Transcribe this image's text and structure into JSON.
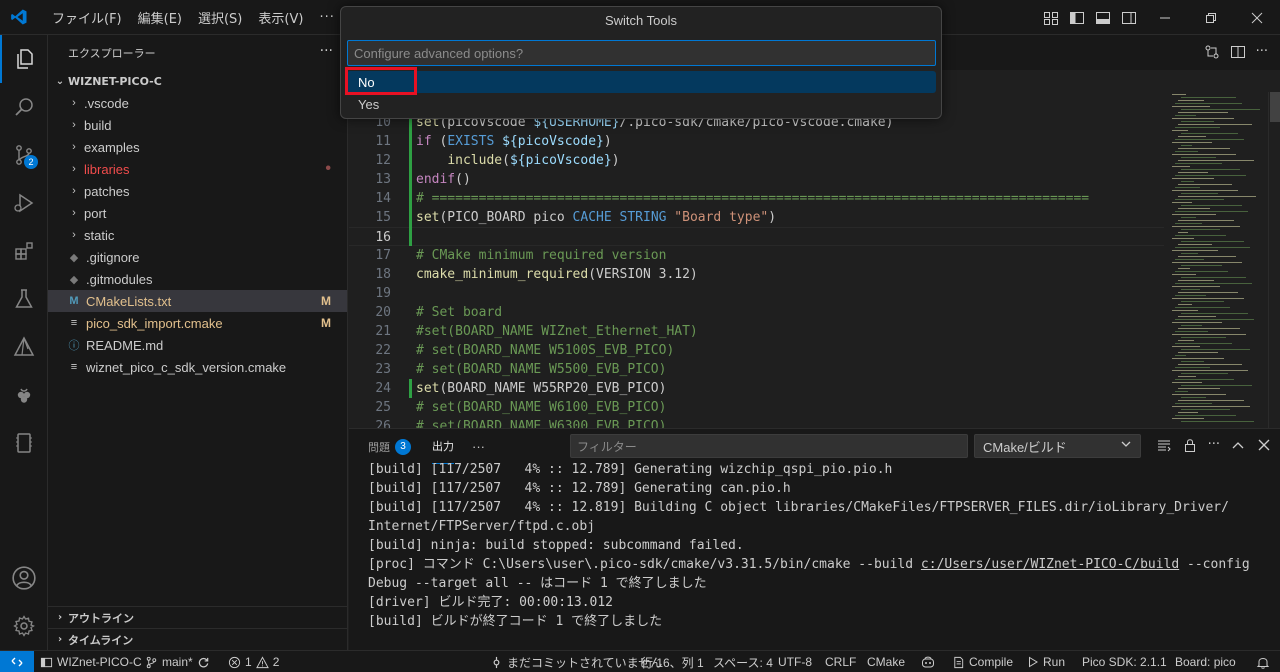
{
  "titlebar": {
    "menus": [
      "ファイル(F)",
      "編集(E)",
      "選択(S)",
      "表示(V)"
    ],
    "more": "···"
  },
  "activity": {
    "badge_scm": "2"
  },
  "sidebar": {
    "header": "エクスプローラー",
    "more": "···",
    "root": "WIZNET-PICO-C",
    "items": [
      {
        "label": ".vscode",
        "type": "folder",
        "color": "#cccccc",
        "deco": ""
      },
      {
        "label": "build",
        "type": "folder",
        "color": "#cccccc",
        "deco": ""
      },
      {
        "label": "examples",
        "type": "folder",
        "color": "#cccccc",
        "deco": ""
      },
      {
        "label": "libraries",
        "type": "folder",
        "color": "#f14c4c",
        "deco": "•"
      },
      {
        "label": "patches",
        "type": "folder",
        "color": "#cccccc",
        "deco": ""
      },
      {
        "label": "port",
        "type": "folder",
        "color": "#cccccc",
        "deco": ""
      },
      {
        "label": "static",
        "type": "folder",
        "color": "#cccccc",
        "deco": ""
      },
      {
        "label": ".gitignore",
        "type": "git",
        "color": "#cccccc",
        "deco": ""
      },
      {
        "label": ".gitmodules",
        "type": "git",
        "color": "#cccccc",
        "deco": ""
      },
      {
        "label": "CMakeLists.txt",
        "type": "cmake",
        "color": "#e2c08d",
        "deco": "M"
      },
      {
        "label": "pico_sdk_import.cmake",
        "type": "lines",
        "color": "#e2c08d",
        "deco": "M"
      },
      {
        "label": "README.md",
        "type": "info",
        "color": "#cccccc",
        "deco": ""
      },
      {
        "label": "wiznet_pico_c_sdk_version.cmake",
        "type": "lines",
        "color": "#cccccc",
        "deco": ""
      }
    ],
    "outline": "アウトライン",
    "timeline": "タイムライン"
  },
  "editor": {
    "lines": [
      {
        "n": "10",
        "segs": [
          [
            "k-fn",
            "set"
          ],
          [
            "k-pl",
            "(picoVscode "
          ],
          [
            "k-var",
            "${USERHOME}"
          ],
          [
            "k-pl",
            "/.pico-sdk/cmake/pico-vscode.cmake)"
          ]
        ]
      },
      {
        "n": "11",
        "segs": [
          [
            "k-ctl",
            "if"
          ],
          [
            "k-pl",
            " ("
          ],
          [
            "k-kw",
            "EXISTS"
          ],
          [
            "k-pl",
            " "
          ],
          [
            "k-var",
            "${picoVscode}"
          ],
          [
            "k-pl",
            ")"
          ]
        ]
      },
      {
        "n": "12",
        "segs": [
          [
            "k-pl",
            "    "
          ],
          [
            "k-fn",
            "include"
          ],
          [
            "k-pl",
            "("
          ],
          [
            "k-var",
            "${picoVscode}"
          ],
          [
            "k-pl",
            ")"
          ]
        ]
      },
      {
        "n": "13",
        "segs": [
          [
            "k-ctl",
            "endif"
          ],
          [
            "k-pl",
            "()"
          ]
        ]
      },
      {
        "n": "14",
        "segs": [
          [
            "k-com",
            "# ===================================================================================="
          ]
        ]
      },
      {
        "n": "15",
        "segs": [
          [
            "k-fn",
            "set"
          ],
          [
            "k-pl",
            "(PICO_BOARD pico "
          ],
          [
            "k-kw",
            "CACHE STRING"
          ],
          [
            "k-pl",
            " "
          ],
          [
            "k-str",
            "\"Board type\""
          ],
          [
            "k-pl",
            ")"
          ]
        ]
      },
      {
        "n": "16",
        "segs": []
      },
      {
        "n": "17",
        "segs": [
          [
            "k-com",
            "# CMake minimum required version"
          ]
        ]
      },
      {
        "n": "18",
        "segs": [
          [
            "k-fn",
            "cmake_minimum_required"
          ],
          [
            "k-pl",
            "(VERSION 3.12)"
          ]
        ]
      },
      {
        "n": "19",
        "segs": []
      },
      {
        "n": "20",
        "segs": [
          [
            "k-com",
            "# Set board"
          ]
        ]
      },
      {
        "n": "21",
        "segs": [
          [
            "k-com",
            "#set(BOARD_NAME WIZnet_Ethernet_HAT)"
          ]
        ]
      },
      {
        "n": "22",
        "segs": [
          [
            "k-com",
            "# set(BOARD_NAME W5100S_EVB_PICO)"
          ]
        ]
      },
      {
        "n": "23",
        "segs": [
          [
            "k-com",
            "# set(BOARD_NAME W5500_EVB_PICO)"
          ]
        ]
      },
      {
        "n": "24",
        "segs": [
          [
            "k-fn",
            "set"
          ],
          [
            "k-pl",
            "(BOARD_NAME W55RP20_EVB_PICO)"
          ]
        ]
      },
      {
        "n": "25",
        "segs": [
          [
            "k-com",
            "# set(BOARD_NAME W6100_EVB_PICO)"
          ]
        ]
      },
      {
        "n": "26",
        "segs": [
          [
            "k-com",
            "# set(BOARD_NAME W6300_EVB_PICO)"
          ]
        ]
      }
    ],
    "current_line": "16"
  },
  "panel": {
    "tabs": [
      {
        "label": "問題",
        "count": "3"
      },
      {
        "label": "出力",
        "count": ""
      }
    ],
    "more": "···",
    "filter_placeholder": "フィルター",
    "channel": "CMake/ビルド",
    "output": [
      "[build] [117/2507   4% :: 12.789] Generating wizchip_qspi_pio.pio.h",
      "[build] [117/2507   4% :: 12.789] Generating can.pio.h",
      "[build] [117/2507   4% :: 12.819] Building C object libraries/CMakeFiles/FTPSERVER_FILES.dir/ioLibrary_Driver/",
      "Internet/FTPServer/ftpd.c.obj",
      "[build] ninja: build stopped: subcommand failed.",
      "[proc] コマンド C:\\Users\\user\\.pico-sdk/cmake/v3.31.5/bin/cmake --build ",
      "Debug --target all -- はコード 1 で終了しました",
      "[driver] ビルド完了: 00:00:13.012",
      "[build] ビルドが終了コード 1 で終了しました"
    ],
    "output_link": "c:/Users/user/WIZnet-PICO-C/build",
    "output_after_link": " --config"
  },
  "statusbar": {
    "branch_folder": "WIZnet-PICO-C",
    "branch": "main*",
    "errors": "1",
    "warnings": "2",
    "no_commit": "まだコミットされていません",
    "position": "行 16、列 1",
    "spaces": "スペース: 4",
    "encoding": "UTF-8",
    "eol": "CRLF",
    "language": "CMake",
    "compile": "Compile",
    "run": "Run",
    "sdk": "Pico SDK: 2.1.1",
    "board": "Board: pico"
  },
  "quickpick": {
    "title": "Switch Tools",
    "placeholder": "Configure advanced options?",
    "items": [
      "No",
      "Yes"
    ]
  },
  "colors": {
    "accent": "#0078d4",
    "highlight_border": "#e81123",
    "selected_item": "#04395e"
  }
}
